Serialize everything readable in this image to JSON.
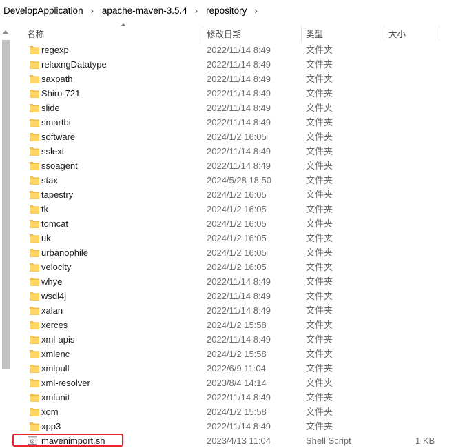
{
  "breadcrumb": {
    "items": [
      "DevelopApplication",
      "apache-maven-3.5.4",
      "repository"
    ],
    "separator": "›"
  },
  "columns": {
    "name": "名称",
    "date": "修改日期",
    "type": "类型",
    "size": "大小"
  },
  "colors": {
    "folder": "#f5c84c",
    "highlight": "#e8262b"
  },
  "rows": [
    {
      "name": "regexp",
      "date": "2022/11/14 8:49",
      "type": "文件夹",
      "size": "",
      "icon": "folder-icon"
    },
    {
      "name": "relaxngDatatype",
      "date": "2022/11/14 8:49",
      "type": "文件夹",
      "size": "",
      "icon": "folder-icon"
    },
    {
      "name": "saxpath",
      "date": "2022/11/14 8:49",
      "type": "文件夹",
      "size": "",
      "icon": "folder-icon"
    },
    {
      "name": "Shiro-721",
      "date": "2022/11/14 8:49",
      "type": "文件夹",
      "size": "",
      "icon": "folder-icon"
    },
    {
      "name": "slide",
      "date": "2022/11/14 8:49",
      "type": "文件夹",
      "size": "",
      "icon": "folder-icon"
    },
    {
      "name": "smartbi",
      "date": "2022/11/14 8:49",
      "type": "文件夹",
      "size": "",
      "icon": "folder-icon"
    },
    {
      "name": "software",
      "date": "2024/1/2 16:05",
      "type": "文件夹",
      "size": "",
      "icon": "folder-icon"
    },
    {
      "name": "sslext",
      "date": "2022/11/14 8:49",
      "type": "文件夹",
      "size": "",
      "icon": "folder-icon"
    },
    {
      "name": "ssoagent",
      "date": "2022/11/14 8:49",
      "type": "文件夹",
      "size": "",
      "icon": "folder-icon"
    },
    {
      "name": "stax",
      "date": "2024/5/28 18:50",
      "type": "文件夹",
      "size": "",
      "icon": "folder-icon"
    },
    {
      "name": "tapestry",
      "date": "2024/1/2 16:05",
      "type": "文件夹",
      "size": "",
      "icon": "folder-icon"
    },
    {
      "name": "tk",
      "date": "2024/1/2 16:05",
      "type": "文件夹",
      "size": "",
      "icon": "folder-icon"
    },
    {
      "name": "tomcat",
      "date": "2024/1/2 16:05",
      "type": "文件夹",
      "size": "",
      "icon": "folder-icon"
    },
    {
      "name": "uk",
      "date": "2024/1/2 16:05",
      "type": "文件夹",
      "size": "",
      "icon": "folder-icon"
    },
    {
      "name": "urbanophile",
      "date": "2024/1/2 16:05",
      "type": "文件夹",
      "size": "",
      "icon": "folder-icon"
    },
    {
      "name": "velocity",
      "date": "2024/1/2 16:05",
      "type": "文件夹",
      "size": "",
      "icon": "folder-icon"
    },
    {
      "name": "whye",
      "date": "2022/11/14 8:49",
      "type": "文件夹",
      "size": "",
      "icon": "folder-icon"
    },
    {
      "name": "wsdl4j",
      "date": "2022/11/14 8:49",
      "type": "文件夹",
      "size": "",
      "icon": "folder-icon"
    },
    {
      "name": "xalan",
      "date": "2022/11/14 8:49",
      "type": "文件夹",
      "size": "",
      "icon": "folder-icon"
    },
    {
      "name": "xerces",
      "date": "2024/1/2 15:58",
      "type": "文件夹",
      "size": "",
      "icon": "folder-icon"
    },
    {
      "name": "xml-apis",
      "date": "2022/11/14 8:49",
      "type": "文件夹",
      "size": "",
      "icon": "folder-icon"
    },
    {
      "name": "xmlenc",
      "date": "2024/1/2 15:58",
      "type": "文件夹",
      "size": "",
      "icon": "folder-icon"
    },
    {
      "name": "xmlpull",
      "date": "2022/6/9 11:04",
      "type": "文件夹",
      "size": "",
      "icon": "folder-icon"
    },
    {
      "name": "xml-resolver",
      "date": "2023/8/4 14:14",
      "type": "文件夹",
      "size": "",
      "icon": "folder-icon"
    },
    {
      "name": "xmlunit",
      "date": "2022/11/14 8:49",
      "type": "文件夹",
      "size": "",
      "icon": "folder-icon"
    },
    {
      "name": "xom",
      "date": "2024/1/2 15:58",
      "type": "文件夹",
      "size": "",
      "icon": "folder-icon"
    },
    {
      "name": "xpp3",
      "date": "2022/11/14 8:49",
      "type": "文件夹",
      "size": "",
      "icon": "folder-icon"
    },
    {
      "name": "mavenimport.sh",
      "date": "2023/4/13 11:04",
      "type": "Shell Script",
      "size": "1 KB",
      "icon": "shell-script-icon",
      "highlighted": true
    }
  ]
}
